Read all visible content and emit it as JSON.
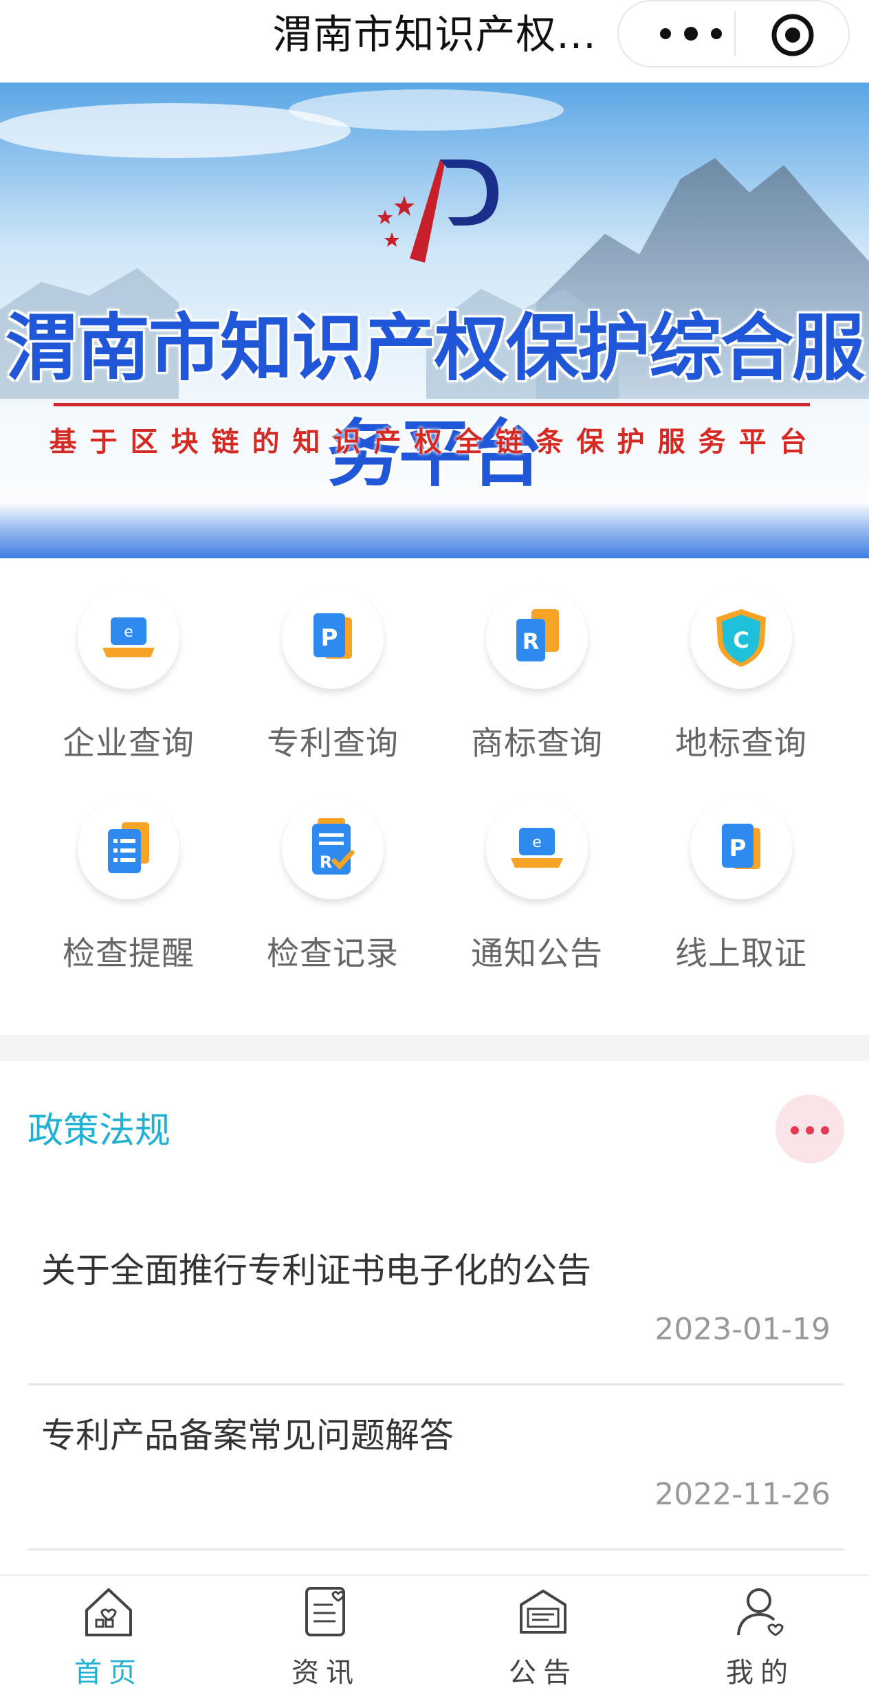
{
  "topbar": {
    "title": "渭南市知识产权..."
  },
  "banner": {
    "title": "渭南市知识产权保护综合服务平台",
    "subtitle": "基于区块链的知识产权全链条保护服务平台"
  },
  "grid": {
    "items": [
      {
        "label": "企业查询",
        "icon": "enterprise-laptop-icon"
      },
      {
        "label": "专利查询",
        "icon": "patent-p-icon"
      },
      {
        "label": "商标查询",
        "icon": "trademark-r-icon"
      },
      {
        "label": "地标查询",
        "icon": "geo-mark-shield-icon"
      },
      {
        "label": "检查提醒",
        "icon": "checklist-icon"
      },
      {
        "label": "检查记录",
        "icon": "record-clipboard-icon"
      },
      {
        "label": "通知公告",
        "icon": "notice-laptop-icon"
      },
      {
        "label": "线上取证",
        "icon": "evidence-p-icon"
      }
    ]
  },
  "policy": {
    "title": "政策法规",
    "items": [
      {
        "title": "关于全面推行专利证书电子化的公告",
        "date": "2023-01-19"
      },
      {
        "title": "专利产品备案常见问题解答",
        "date": "2022-11-26"
      }
    ]
  },
  "tabbar": {
    "items": [
      {
        "label": "首页",
        "icon": "home-icon",
        "active": true
      },
      {
        "label": "资讯",
        "icon": "news-icon",
        "active": false
      },
      {
        "label": "公告",
        "icon": "announcement-icon",
        "active": false
      },
      {
        "label": "我的",
        "icon": "profile-icon",
        "active": false
      }
    ]
  },
  "colors": {
    "accent": "#1fb0d3",
    "banner_title": "#1f57d8",
    "banner_subtitle": "#d52a24",
    "more_dot": "#e7394f"
  }
}
